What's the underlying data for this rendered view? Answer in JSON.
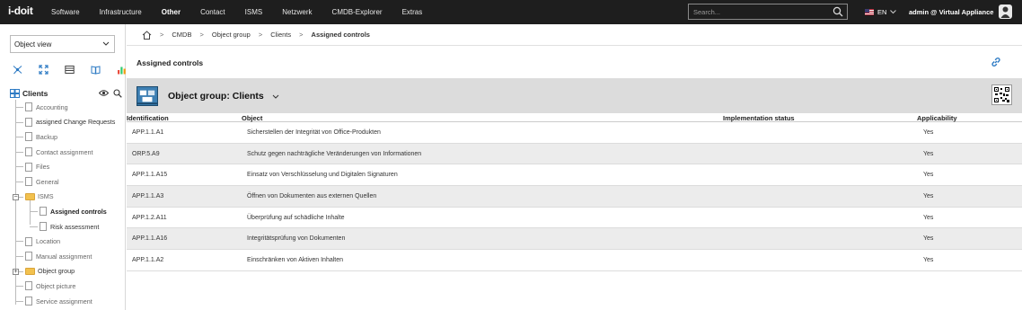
{
  "app": {
    "logo": "i-doit",
    "nav": [
      "Software",
      "Infrastructure",
      "Other",
      "Contact",
      "ISMS",
      "Netzwerk",
      "CMDB-Explorer",
      "Extras"
    ],
    "nav_active": "Other",
    "search_placeholder": "Search...",
    "language": "EN",
    "user": "admin @ Virtual Appliance"
  },
  "sidebar": {
    "view_select": "Object view",
    "root_label": "Clients",
    "items": [
      {
        "label": "Accounting"
      },
      {
        "label": "assigned Change Requests"
      },
      {
        "label": "Backup"
      },
      {
        "label": "Contact assignment"
      },
      {
        "label": "Files"
      },
      {
        "label": "General"
      },
      {
        "label": "ISMS"
      },
      {
        "label": "Assigned controls"
      },
      {
        "label": "Risk assessment"
      },
      {
        "label": "Location"
      },
      {
        "label": "Manual assignment"
      },
      {
        "label": "Object group"
      },
      {
        "label": "Object picture"
      },
      {
        "label": "Service assignment"
      }
    ]
  },
  "breadcrumb": [
    "CMDB",
    "Object group",
    "Clients",
    "Assigned controls"
  ],
  "page": {
    "title": "Assigned controls"
  },
  "object": {
    "title": "Object group: Clients"
  },
  "table": {
    "headers": [
      "Identification",
      "Object",
      "Implementation status",
      "Applicability"
    ],
    "rows": [
      {
        "id": "APP.1.1.A1",
        "object": "Sicherstellen der Integrität von Office-Produkten",
        "status": "",
        "applicability": "Yes"
      },
      {
        "id": "ORP.5.A9",
        "object": "Schutz gegen nachträgliche Veränderungen von Informationen",
        "status": "",
        "applicability": "Yes"
      },
      {
        "id": "APP.1.1.A15",
        "object": "Einsatz von Verschlüsselung und Digitalen Signaturen",
        "status": "",
        "applicability": "Yes"
      },
      {
        "id": "APP.1.1.A3",
        "object": "Öffnen von Dokumenten aus externen Quellen",
        "status": "",
        "applicability": "Yes"
      },
      {
        "id": "APP.1.2.A11",
        "object": "Überprüfung auf schädliche Inhalte",
        "status": "",
        "applicability": "Yes"
      },
      {
        "id": "APP.1.1.A16",
        "object": "Integritätsprüfung von Dokumenten",
        "status": "",
        "applicability": "Yes"
      },
      {
        "id": "APP.1.1.A2",
        "object": "Einschränken von Aktiven Inhalten",
        "status": "",
        "applicability": "Yes"
      }
    ]
  }
}
